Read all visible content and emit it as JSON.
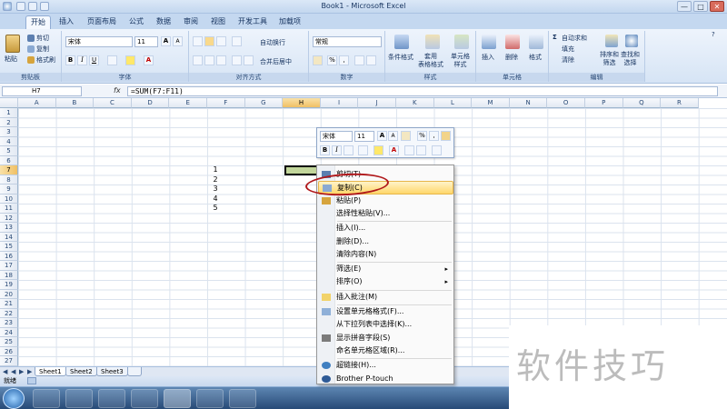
{
  "window": {
    "title": "Book1 - Microsoft Excel",
    "minimize": "—",
    "maximize": "□",
    "close": "✕"
  },
  "tabs": [
    "开始",
    "插入",
    "页面布局",
    "公式",
    "数据",
    "审阅",
    "视图",
    "开发工具",
    "加载项"
  ],
  "ribbon": {
    "clipboard": {
      "label": "剪贴板",
      "paste": "粘贴",
      "cut": "剪切",
      "copy": "复制",
      "format_painter": "格式刷"
    },
    "font": {
      "label": "字体",
      "font_name": "宋体",
      "font_size": "11",
      "bold": "B",
      "italic": "I",
      "underline": "U",
      "grow": "A",
      "shrink": "A"
    },
    "alignment": {
      "label": "对齐方式",
      "wrap": "自动换行",
      "merge": "合并后居中"
    },
    "number": {
      "label": "数字",
      "format": "常规",
      "percent": "%",
      "comma": ","
    },
    "styles": {
      "label": "样式",
      "conditional": "条件格式",
      "table": "套用\n表格格式",
      "cell": "单元格\n样式"
    },
    "cells": {
      "label": "单元格",
      "insert": "插入",
      "delete": "删除",
      "format": "格式"
    },
    "editing": {
      "label": "编辑",
      "autosum": "自动求和",
      "fill": "填充",
      "clear": "清除",
      "sort": "排序和\n筛选",
      "find": "查找和\n选择"
    }
  },
  "formula_bar": {
    "name_box": "H7",
    "fx": "fx",
    "formula": "=SUM(F7:F11)"
  },
  "columns": [
    "A",
    "B",
    "C",
    "D",
    "E",
    "F",
    "G",
    "H",
    "I",
    "J",
    "K",
    "L",
    "M",
    "N",
    "O",
    "P",
    "Q",
    "R"
  ],
  "selected_column": "H",
  "rows": [
    "1",
    "2",
    "3",
    "4",
    "5",
    "6",
    "7",
    "8",
    "9",
    "10",
    "11",
    "12",
    "13",
    "14",
    "15",
    "16",
    "17",
    "18",
    "19",
    "20",
    "21",
    "22",
    "23",
    "24",
    "25",
    "26",
    "27"
  ],
  "selected_row": "7",
  "cell_values": [
    {
      "row": "7",
      "value": "1"
    },
    {
      "row": "8",
      "value": "2"
    },
    {
      "row": "9",
      "value": "3"
    },
    {
      "row": "10",
      "value": "4"
    },
    {
      "row": "11",
      "value": "5"
    }
  ],
  "mini_toolbar": {
    "font_name": "宋体",
    "font_size": "11",
    "bold": "B",
    "italic": "I",
    "percent": "%",
    "comma": ","
  },
  "context_menu": {
    "items": [
      {
        "label": "剪切(T)",
        "icon": "scissors-icon"
      },
      {
        "label": "复制(C)",
        "icon": "copy-icon",
        "highlighted": true
      },
      {
        "label": "粘贴(P)",
        "icon": "paste-icon"
      },
      {
        "label": "选择性粘贴(V)..."
      },
      {
        "label": "插入(I)..."
      },
      {
        "label": "删除(D)..."
      },
      {
        "label": "清除内容(N)"
      },
      {
        "label": "筛选(E)",
        "submenu": true
      },
      {
        "label": "排序(O)",
        "submenu": true
      },
      {
        "label": "插入批注(M)",
        "icon": "comment-icon"
      },
      {
        "label": "设置单元格格式(F)...",
        "icon": "format-cells-icon"
      },
      {
        "label": "从下拉列表中选择(K)..."
      },
      {
        "label": "显示拼音字段(S)",
        "icon": "phonetic-icon"
      },
      {
        "label": "命名单元格区域(R)..."
      },
      {
        "label": "超链接(H)...",
        "icon": "hyperlink-icon"
      },
      {
        "label": "Brother P-touch",
        "icon": "brother-icon"
      }
    ]
  },
  "sheets": [
    "Sheet1",
    "Sheet2",
    "Sheet3"
  ],
  "active_sheet": "Sheet1",
  "status": {
    "ready": "就绪"
  },
  "watermark": "软件技巧",
  "colors": {
    "accent": "#c4d8f0",
    "highlight": "#ffd76a",
    "circle": "#b0181b"
  }
}
